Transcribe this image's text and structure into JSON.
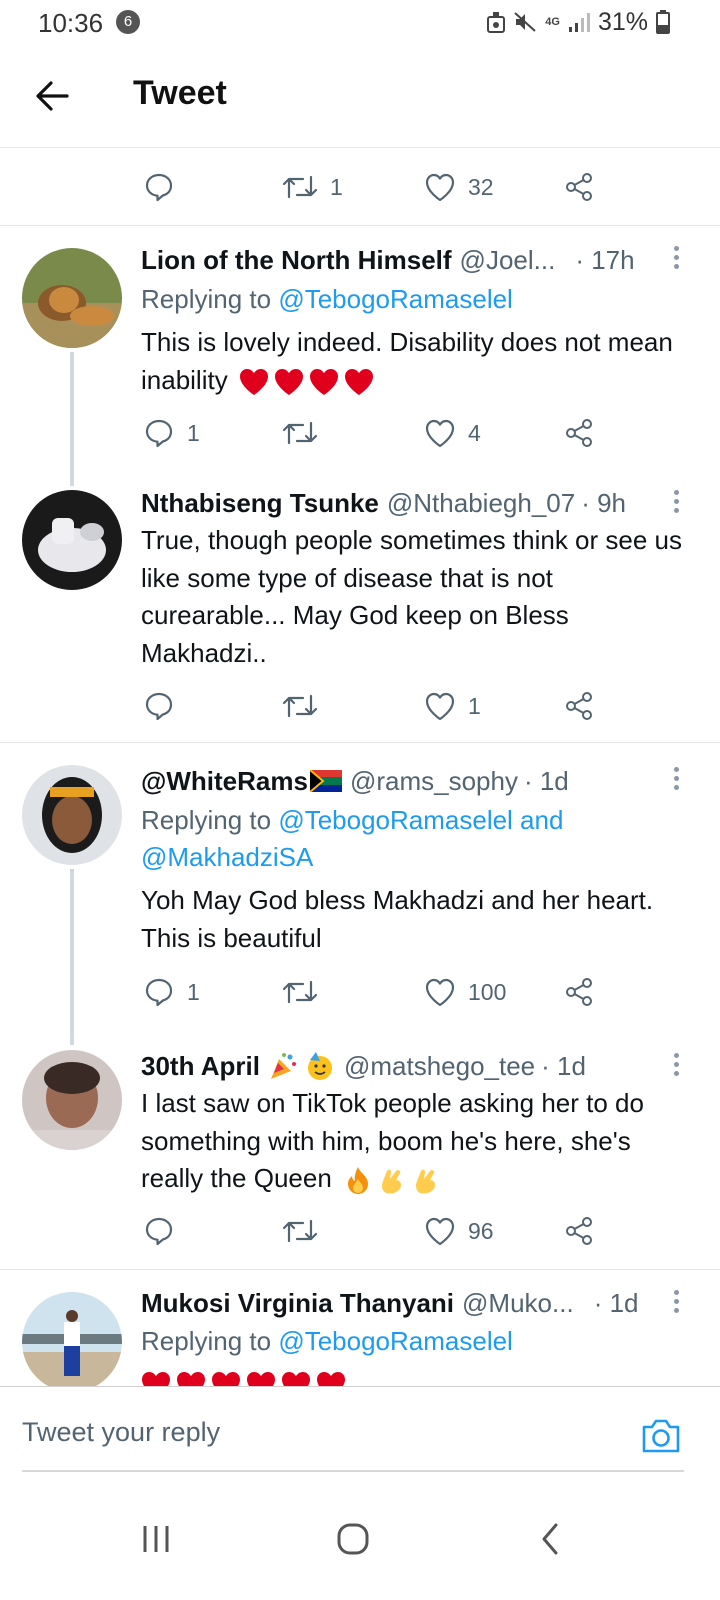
{
  "status": {
    "time": "10:36",
    "notification_count": "6",
    "network": "4G",
    "battery": "31%"
  },
  "header": {
    "title": "Tweet"
  },
  "top_actions": {
    "reply_count": "",
    "retweet_count": "1",
    "like_count": "32"
  },
  "tweets": [
    {
      "name": "Lion of the North Himself",
      "handle": "@Joel...",
      "time": "· 17h",
      "replying_label": "Replying to",
      "replying_to": "@TebogoRamaselel",
      "replying_to_2": "",
      "text": "This is lovely indeed. Disability does not mean inability",
      "emoji": "heart ×4",
      "reply_count": "1",
      "retweet_count": "",
      "like_count": "4"
    },
    {
      "name": "Nthabiseng Tsunke",
      "handle": "@Nthabiegh_07",
      "time": "· 9h",
      "text": "True, though people sometimes think or see us like some type of disease that is not curearable... May God keep on Bless Makhadzi..",
      "reply_count": "",
      "retweet_count": "",
      "like_count": "1"
    },
    {
      "name": "@WhiteRams",
      "handle": "@rams_sophy",
      "time": "· 1d",
      "replying_label": "Replying to",
      "replying_to": "@TebogoRamaselel and",
      "replying_to_2": "@MakhadziSA",
      "text": "Yoh May God bless Makhadzi and her heart. This is beautiful",
      "reply_count": "1",
      "retweet_count": "",
      "like_count": "100"
    },
    {
      "name": "30th April",
      "handle": "@matshego_tee",
      "time": "· 1d",
      "text": "I last saw on TikTok people asking her to do something with him, boom he's here, she's really the Queen",
      "reply_count": "",
      "retweet_count": "",
      "like_count": "96"
    },
    {
      "name": "Mukosi Virginia Thanyani",
      "handle": "@Muko...",
      "time": "· 1d",
      "replying_label": "Replying to",
      "replying_to": "@TebogoRamaselel"
    }
  ],
  "reply_bar": {
    "placeholder": "Tweet your reply"
  },
  "colors": {
    "accent": "#1d9bf0",
    "text": "#0f1419",
    "muted": "#536471",
    "heart": "#e0001e"
  }
}
